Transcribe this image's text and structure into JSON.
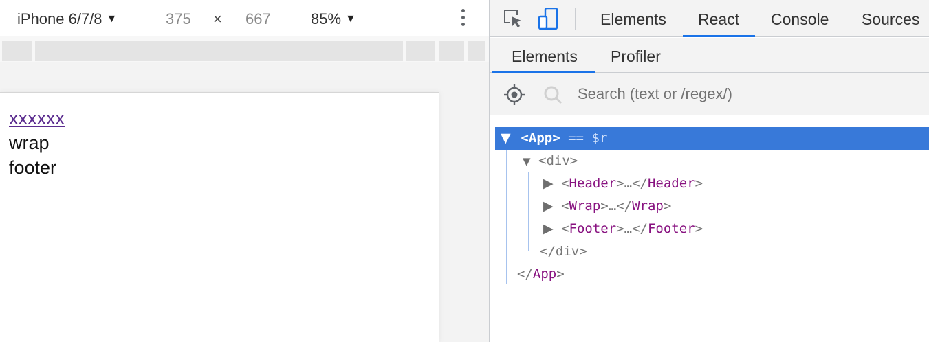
{
  "device_toolbar": {
    "device": "iPhone 6/7/8",
    "width": "375",
    "times": "×",
    "height": "667",
    "zoom": "85%"
  },
  "page": {
    "link": "xxxxxx",
    "wrap": "wrap",
    "footer": "footer"
  },
  "devtools": {
    "main_tabs": [
      "Elements",
      "React",
      "Console",
      "Sources"
    ],
    "active_main_tab": "React",
    "sub_tabs": [
      "Elements",
      "Profiler"
    ],
    "active_sub_tab": "Elements",
    "search_placeholder": "Search (text or /regex/)"
  },
  "tree": {
    "app_open": "<App>",
    "app_suffix": " == $r",
    "div_open": "<div>",
    "header": {
      "open": "Header",
      "close": "Header"
    },
    "wrap": {
      "open": "Wrap",
      "close": "Wrap"
    },
    "footer": {
      "open": "Footer",
      "close": "Footer"
    },
    "ellipsis": "…",
    "div_close": "</div>",
    "app_close_name": "App"
  },
  "colors": {
    "accent": "#1a73e8",
    "selected_row": "#3879d9",
    "tag": "#881280",
    "link": "#5b2c8f"
  },
  "icons": [
    "inspect-element-icon",
    "device-toggle-icon",
    "kebab-menu-icon",
    "select-component-icon",
    "search-icon",
    "expand-triangle-icon",
    "collapse-triangle-icon"
  ]
}
